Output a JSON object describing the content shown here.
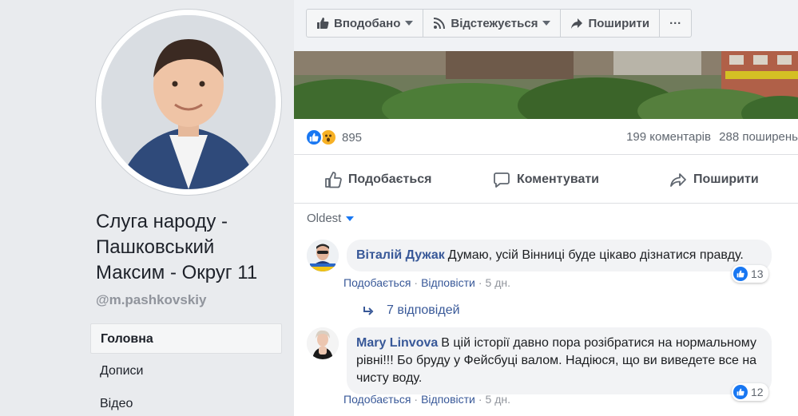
{
  "sidebar": {
    "page_name": "Слуга народу - Пашковський Максим - Округ 11",
    "handle": "@m.pashkovskiy",
    "nav": [
      {
        "label": "Головна",
        "active": true
      },
      {
        "label": "Дописи",
        "active": false
      },
      {
        "label": "Відео",
        "active": false
      }
    ]
  },
  "actionbar": {
    "liked": "Вподобано",
    "following": "Відстежується",
    "share": "Поширити",
    "more": "···"
  },
  "post": {
    "reaction_count": "895",
    "comments": "199 коментарів",
    "shares": "288 поширень",
    "buttons": {
      "like": "Подобається",
      "comment": "Коментувати",
      "share": "Поширити"
    }
  },
  "comments_section": {
    "sort": "Oldest",
    "comments": [
      {
        "author": "Віталій Дужак",
        "text": "Думаю, усій Вінниці буде цікаво дізнатися правду.",
        "like": "Подобається",
        "reply": "Відповісти",
        "time": "5 дн.",
        "likes": "13"
      },
      {
        "author": "Mary Linvova",
        "text": "В цій історії давно пора розібратися на нормальному рівні!!! Бо бруду у Фейсбуці валом. Надіюся, що ви виведете все на чисту воду.",
        "like": "Подобається",
        "reply": "Відповісти",
        "time": "5 дн.",
        "likes": "12"
      }
    ],
    "replies_label": "7 відповідей"
  },
  "colors": {
    "accent": "#1877f2",
    "link": "#385898"
  }
}
